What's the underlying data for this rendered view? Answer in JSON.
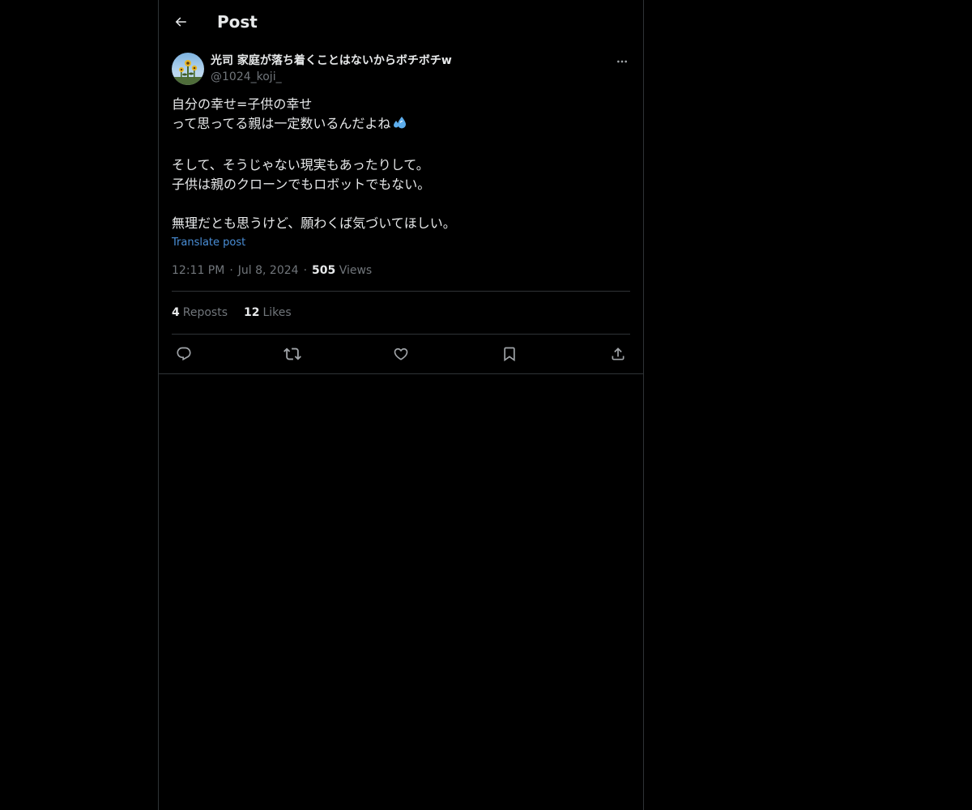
{
  "header": {
    "title": "Post",
    "back_icon": "arrow-left-icon"
  },
  "post": {
    "author": {
      "display_name": "光司 家庭が落ち着くことはないからボチボチw",
      "handle": "@1024_koji_",
      "avatar_icon": "avatar-sunflower"
    },
    "body_lines": [
      "自分の幸せ=子供の幸せ",
      "って思ってる親は一定数いるんだよね",
      "",
      "そして、そうじゃない現実もあったりして。",
      "子供は親のクローンでもロボットでもない。",
      "",
      "無理だとも思うけど、願わくば気づいてほしい。"
    ],
    "body_emoji": "sweat-droplets-icon",
    "translate_label": "Translate post",
    "time": "12:11 PM",
    "date": "Jul 8, 2024",
    "separator": "·",
    "views_count": "505",
    "views_label": "Views",
    "reposts_count": "4",
    "reposts_label": "Reposts",
    "likes_count": "12",
    "likes_label": "Likes"
  },
  "actions": [
    "reply-icon",
    "repost-icon",
    "like-icon",
    "bookmark-icon",
    "share-icon"
  ],
  "colors": {
    "background": "#000000",
    "text": "#e7e9ea",
    "secondary": "#71767b",
    "border": "#2f3336",
    "link": "#4a8fd8"
  }
}
